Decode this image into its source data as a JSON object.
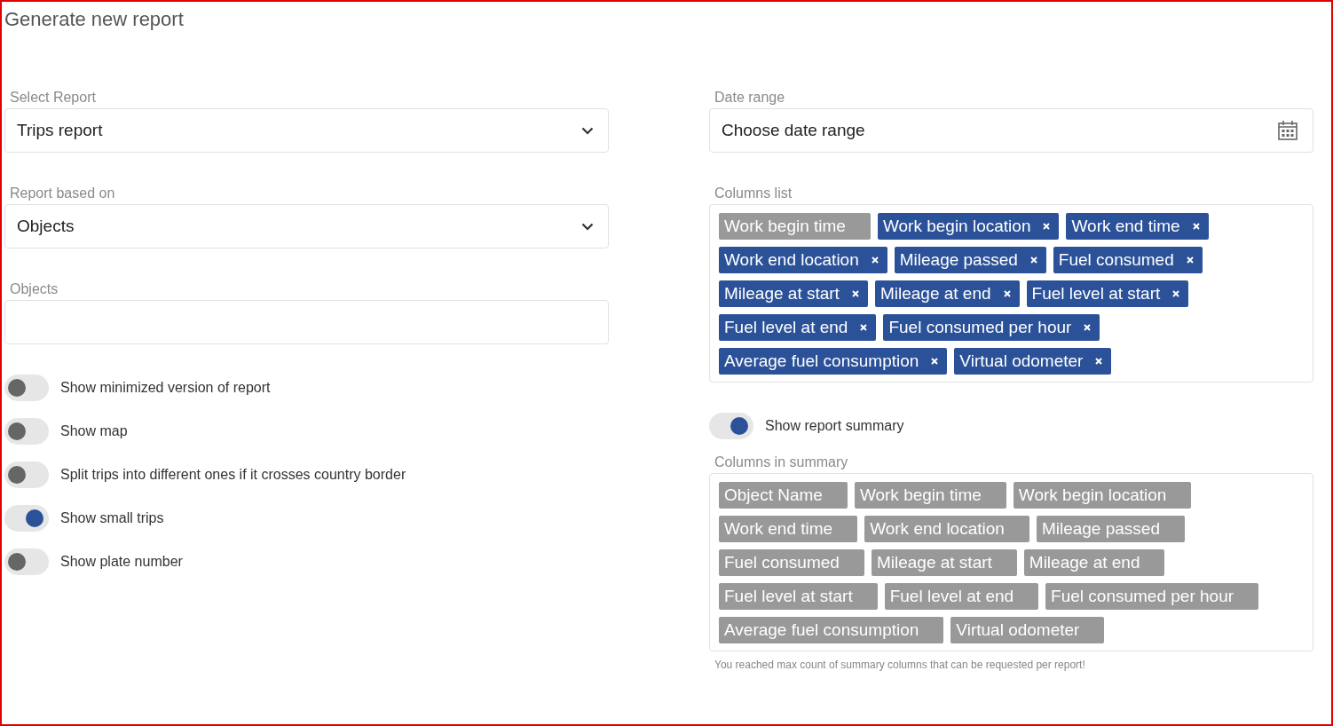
{
  "title": "Generate new report",
  "left": {
    "fields": [
      {
        "label": "Select Report",
        "kind": "select",
        "value": "Trips report"
      },
      {
        "label": "Report based on",
        "kind": "select",
        "value": "Objects"
      },
      {
        "label": "Objects",
        "kind": "text"
      }
    ],
    "toggles": [
      {
        "label": "Show minimized version of report",
        "on": false
      },
      {
        "label": "Show map",
        "on": false
      },
      {
        "label": "Split trips into different ones if it crosses country border",
        "on": false
      },
      {
        "label": "Show small trips",
        "on": true
      },
      {
        "label": "Show plate number",
        "on": false
      }
    ]
  },
  "right": {
    "date_range": {
      "label": "Date range",
      "placeholder": "Choose date range"
    },
    "columns_list": {
      "label": "Columns list",
      "chips": [
        {
          "label": "Work begin time",
          "selected": false
        },
        {
          "label": "Work begin location",
          "selected": true
        },
        {
          "label": "Work end time",
          "selected": true
        },
        {
          "label": "Work end location",
          "selected": true
        },
        {
          "label": "Mileage passed",
          "selected": true
        },
        {
          "label": "Fuel consumed",
          "selected": true
        },
        {
          "label": "Mileage at start",
          "selected": true
        },
        {
          "label": "Mileage at end",
          "selected": true
        },
        {
          "label": "Fuel level at start",
          "selected": true
        },
        {
          "label": "Fuel level at end",
          "selected": true
        },
        {
          "label": "Fuel consumed per hour",
          "selected": true
        },
        {
          "label": "Average fuel consumption",
          "selected": true
        },
        {
          "label": "Virtual odometer",
          "selected": true
        }
      ]
    },
    "summary_toggle": {
      "label": "Show report summary",
      "on": true
    },
    "columns_in_summary": {
      "label": "Columns in summary",
      "chips": [
        {
          "label": "Object Name",
          "selected": false
        },
        {
          "label": "Work begin time",
          "selected": false
        },
        {
          "label": "Work begin location",
          "selected": false
        },
        {
          "label": "Work end time",
          "selected": false
        },
        {
          "label": "Work end location",
          "selected": false
        },
        {
          "label": "Mileage passed",
          "selected": false
        },
        {
          "label": "Fuel consumed",
          "selected": false
        },
        {
          "label": "Mileage at start",
          "selected": false
        },
        {
          "label": "Mileage at end",
          "selected": false
        },
        {
          "label": "Fuel level at start",
          "selected": false
        },
        {
          "label": "Fuel level at end",
          "selected": false
        },
        {
          "label": "Fuel consumed per hour",
          "selected": false
        },
        {
          "label": "Average fuel consumption",
          "selected": false
        },
        {
          "label": "Virtual odometer",
          "selected": false
        }
      ],
      "note": "You reached max count of summary columns that can be requested per report!"
    }
  }
}
